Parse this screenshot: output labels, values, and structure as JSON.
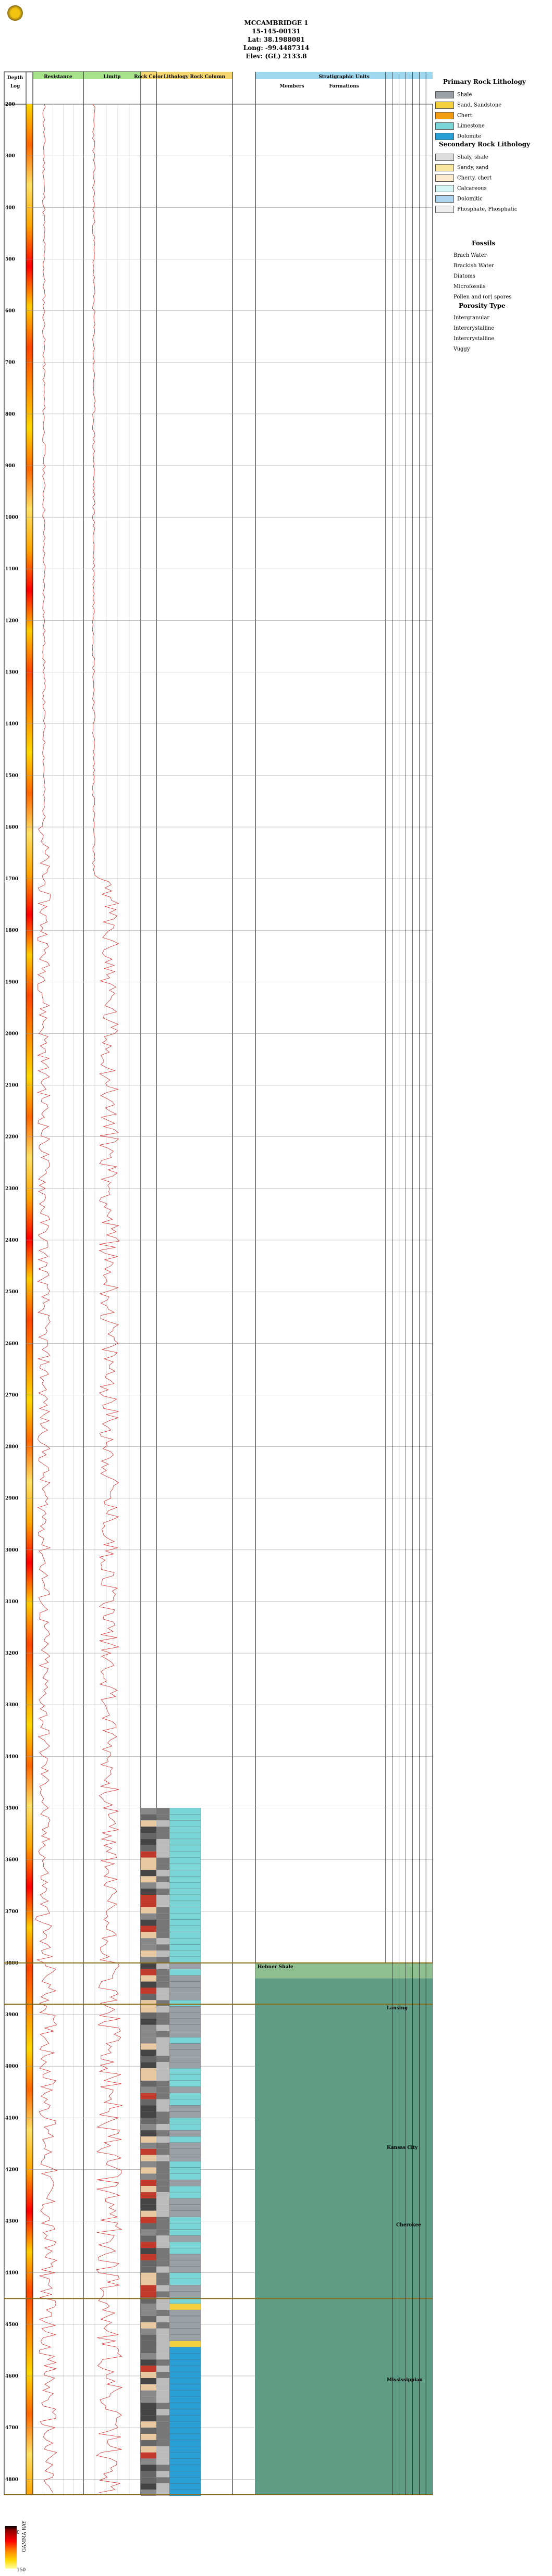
{
  "well": {
    "name": "MCCAMBRIDGE 1",
    "api": "15-145-00131",
    "lat": "Lat: 38.1988081",
    "long": "Long: -99.4487314",
    "elev": "Elev: (GL) 2133.8"
  },
  "track_headers": {
    "depth": "Depth",
    "log": "Log",
    "gamma_ray": "Gamma Ray",
    "resistance": "Resistance",
    "limerp": "Limitp",
    "rock_color": "Rock Color",
    "lithology": "Lithology Rock Column",
    "stratigraphic": "Stratigraphic Units",
    "members": "Members",
    "formations": "Formations"
  },
  "depth_ticks": [
    "200",
    "300",
    "400",
    "500",
    "600",
    "700",
    "800",
    "900",
    "1000",
    "1100",
    "1200",
    "1300",
    "1400",
    "1500",
    "1600",
    "1700",
    "1800",
    "1900",
    "2000",
    "2100",
    "2200",
    "2300",
    "2400",
    "2500",
    "2600",
    "2700",
    "2800",
    "2900",
    "3000",
    "3100",
    "3200",
    "3300",
    "3400",
    "3500",
    "3600",
    "3700",
    "3800",
    "3900",
    "4000",
    "4100",
    "4200",
    "4300",
    "4400",
    "4500",
    "4600",
    "4700",
    "4800"
  ],
  "strat_units": [
    {
      "label": "Hebner Shale"
    },
    {
      "label": "Lansing"
    },
    {
      "label": "Kansas City"
    },
    {
      "label": "Cherokee"
    },
    {
      "label": "Mississippian"
    }
  ],
  "legend": {
    "primary_title": "Primary Rock Lithology",
    "primary": [
      "Shale",
      "Sand, Sandstone",
      "Chert",
      "Limestone",
      "Dolomite"
    ],
    "secondary_title": "Secondary Rock Lithology",
    "secondary": [
      "Shaly, shale",
      "Sandy, sand",
      "Cherty, chert",
      "Calcareous",
      "Dolomitic",
      "Phosphate, Phosphatic"
    ],
    "fossils_title": "Fossils",
    "fossils": [
      "Brach Water",
      "Brackish Water",
      "Diatoms",
      "Microfossils",
      "Pollen and (or) spores"
    ],
    "porosity_title": "Porosity Type",
    "porosity": [
      "Intergranular",
      "Intercrystalline",
      "Intercrystalline",
      "Vuggy"
    ]
  },
  "gr_scale": {
    "min": "0",
    "max": "150",
    "label": "GAMMA RAY"
  },
  "colors": {
    "header_green": "#a6e38b",
    "header_blue": "#9fd8ee",
    "strat_fill": "#5f9c86",
    "strat_fill_light": "#8fbf90",
    "shale": "#9aa0a6",
    "limestone": "#7ad6d6",
    "dolomite": "#2a9fd6",
    "sand": "#f4d03f",
    "log_red": "#d62a2a"
  }
}
